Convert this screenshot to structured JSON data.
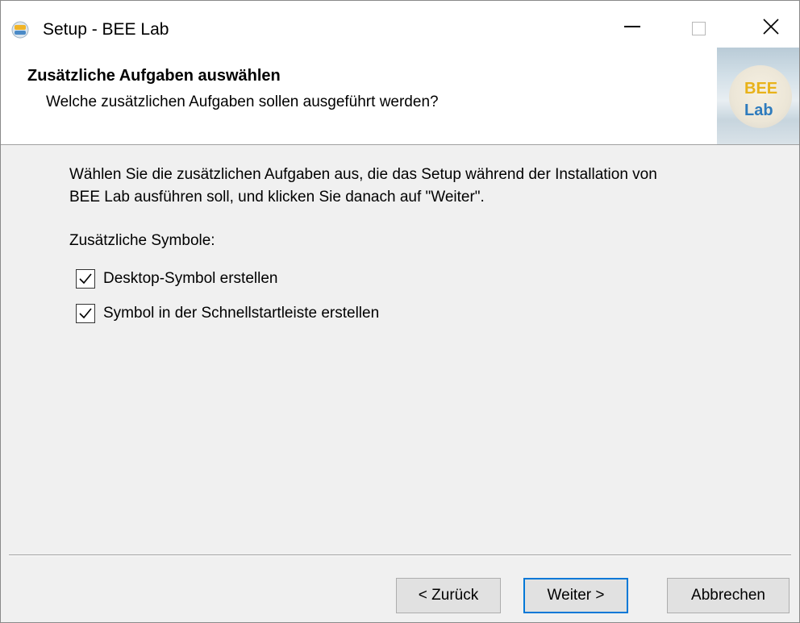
{
  "window": {
    "title": "Setup - BEE Lab",
    "app_icon": "bee-lab-app-icon",
    "controls": {
      "minimize": "minimize-icon",
      "maximize": "maximize-icon",
      "close": "close-icon"
    }
  },
  "header": {
    "title": "Zusätzliche Aufgaben auswählen",
    "subtitle": "Welche zusätzlichen Aufgaben sollen ausgeführt werden?",
    "logo": {
      "line1": "BEE",
      "line2": "Lab"
    }
  },
  "body": {
    "description_line1": "Wählen Sie die zusätzlichen Aufgaben aus, die das Setup während der Installation von",
    "description_line2": "BEE Lab ausführen soll, und klicken Sie danach auf \"Weiter\".",
    "group_label": "Zusätzliche Symbole:",
    "tasks": [
      {
        "label": "Desktop-Symbol erstellen",
        "checked": true
      },
      {
        "label": "Symbol in der Schnellstartleiste erstellen",
        "checked": true
      }
    ]
  },
  "buttons": {
    "back": "< Zurück",
    "next": "Weiter >",
    "cancel": "Abbrechen"
  },
  "colors": {
    "accent": "#0078d7",
    "logo_bee": "#e8b21a",
    "logo_lab": "#2e7bbd",
    "dialog_bg": "#f0f0f0"
  }
}
